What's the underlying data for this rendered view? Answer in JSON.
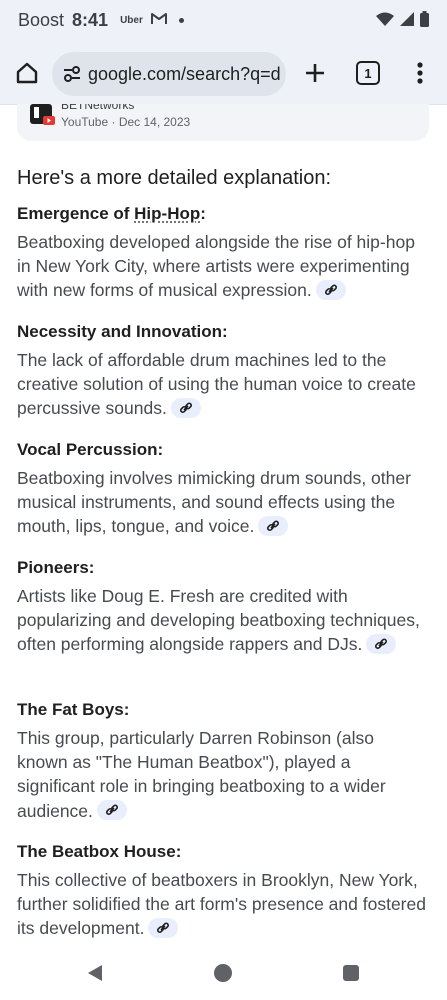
{
  "status_bar": {
    "carrier": "Boost",
    "time": "8:41",
    "notif_uber": "Uber",
    "icons": [
      "uber-icon",
      "gmail-icon",
      "dot-icon",
      "wifi-icon",
      "signal-icon",
      "battery-icon"
    ]
  },
  "browser": {
    "url": "google.com/search?q=d",
    "tab_count": "1",
    "icons": [
      "home-icon",
      "site-settings-icon",
      "new-tab-icon",
      "kebab-menu-icon"
    ]
  },
  "source": {
    "name": "BETNetworks",
    "meta": "YouTube · Dec 14, 2023"
  },
  "intro": "Here's a more detailed explanation:",
  "sections": [
    {
      "title_pre": "Emergence of ",
      "title_link": "Hip-Hop",
      "title_post": ":",
      "body": "Beatboxing developed alongside the rise of hip-hop in New York City, where artists were experimenting with new forms of musical expression."
    },
    {
      "title": "Necessity and Innovation:",
      "body": "The lack of affordable drum machines led to the creative solution of using the human voice to create percussive sounds."
    },
    {
      "title": "Vocal Percussion:",
      "body": "Beatboxing involves mimicking drum sounds, other musical instruments, and sound effects using the mouth, lips, tongue, and voice."
    },
    {
      "title": "Pioneers:",
      "body": "Artists like Doug E. Fresh are credited with popularizing and developing beatboxing techniques, often performing alongside rappers and DJs."
    },
    {
      "title": "The Fat Boys:",
      "body": "This group, particularly Darren Robinson (also known as \"The Human Beatbox\"), played a significant role in bringing beatboxing to a wider audience."
    },
    {
      "title": "The Beatbox House:",
      "body": "This collective of beatboxers in Brooklyn, New York, further solidified the art form's presence and fostered its development."
    }
  ],
  "nav": {
    "icons": [
      "back-icon",
      "home-circle-icon",
      "recents-icon"
    ]
  },
  "colors": {
    "chrome_bg": "#eef1f8",
    "url_bar_bg": "#dfe3ec",
    "chip_bg": "#e8eefb",
    "body_text": "#474b51",
    "heading_text": "#1f1f1f"
  }
}
